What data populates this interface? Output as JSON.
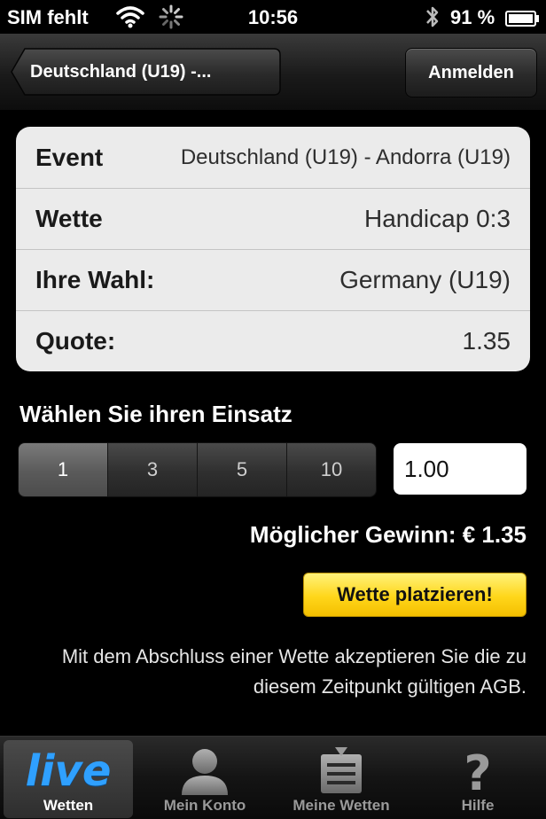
{
  "status_bar": {
    "carrier": "SIM fehlt",
    "time": "10:56",
    "battery_percent": "91 %"
  },
  "nav": {
    "back_label": "Deutschland (U19) -...",
    "login_label": "Anmelden"
  },
  "bet_details": {
    "rows": [
      {
        "label": "Event",
        "value": "Deutschland (U19) - Andorra (U19)"
      },
      {
        "label": "Wette",
        "value": "Handicap 0:3"
      },
      {
        "label": "Ihre Wahl:",
        "value": "Germany (U19)"
      },
      {
        "label": "Quote:",
        "value": "1.35"
      }
    ]
  },
  "stake": {
    "title": "Wählen Sie ihren Einsatz",
    "options": [
      "1",
      "3",
      "5",
      "10"
    ],
    "selected_index": 0,
    "input_value": "1.00"
  },
  "possible_gain": "Möglicher Gewinn: € 1.35",
  "place_bet_label": "Wette platzieren!",
  "agb_notice": "Mit dem Abschluss einer Wette akzeptieren Sie die zu diesem Zeitpunkt gültigen AGB.",
  "tabbar": {
    "tabs": [
      {
        "logo_text": "live",
        "label": "Wetten",
        "icon": "live-logo",
        "active": true
      },
      {
        "label": "Mein Konto",
        "icon": "person-icon",
        "active": false
      },
      {
        "label": "Meine Wetten",
        "icon": "bet-slip-icon",
        "active": false
      },
      {
        "label": "Hilfe",
        "icon": "question-mark-icon",
        "active": false
      }
    ]
  },
  "colors": {
    "accent_blue": "#2fa0ff",
    "button_yellow": "#ffd61a",
    "card_background": "#ebebeb"
  }
}
